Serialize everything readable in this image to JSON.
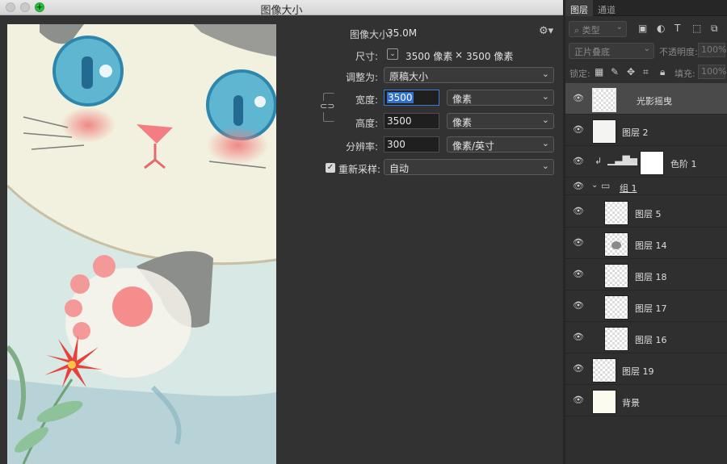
{
  "window": {
    "title": "图像大小"
  },
  "form": {
    "image_size_label": "图像大小:",
    "image_size_value": "35.0M",
    "dimensions_label": "尺寸:",
    "dimensions_width": "3500 像素",
    "dimensions_sep": "×",
    "dimensions_height": "3500 像素",
    "fit_to_label": "调整为:",
    "fit_to_value": "原稿大小",
    "width_label": "宽度:",
    "width_value": "3500",
    "width_unit": "像素",
    "height_label": "高度:",
    "height_value": "3500",
    "height_unit": "像素",
    "resolution_label": "分辨率:",
    "resolution_value": "300",
    "resolution_unit": "像素/英寸",
    "resample_label": "重新采样:",
    "resample_checked": true,
    "resample_value": "自动"
  },
  "panel": {
    "tabs": [
      "图层",
      "通道"
    ],
    "filter_kind": "类型",
    "blend_mode": "正片叠底",
    "opacity_label": "不透明度:",
    "opacity_value": "100%",
    "lock_label": "锁定:",
    "fill_label": "填充:",
    "fill_value": "100%",
    "layers": [
      {
        "name": "光影摇曳",
        "selected": true,
        "type": "pixel"
      },
      {
        "name": "图层 2",
        "type": "pixel"
      },
      {
        "name": "色阶 1",
        "type": "adjustment",
        "clipped": true
      },
      {
        "name": "组 1",
        "type": "group"
      },
      {
        "name": "图层 5",
        "type": "pixel",
        "indent": true
      },
      {
        "name": "图层 14",
        "type": "pixel",
        "indent": true
      },
      {
        "name": "图层 18",
        "type": "pixel",
        "indent": true
      },
      {
        "name": "图层 17",
        "type": "pixel",
        "indent": true
      },
      {
        "name": "图层 16",
        "type": "pixel",
        "indent": true
      },
      {
        "name": "图层 19",
        "type": "pixel"
      },
      {
        "name": "背景",
        "type": "background"
      }
    ]
  },
  "colors": {
    "accent": "#2f6fd0",
    "panel_bg": "#2f2f2f",
    "dialog_bg": "#323232"
  }
}
